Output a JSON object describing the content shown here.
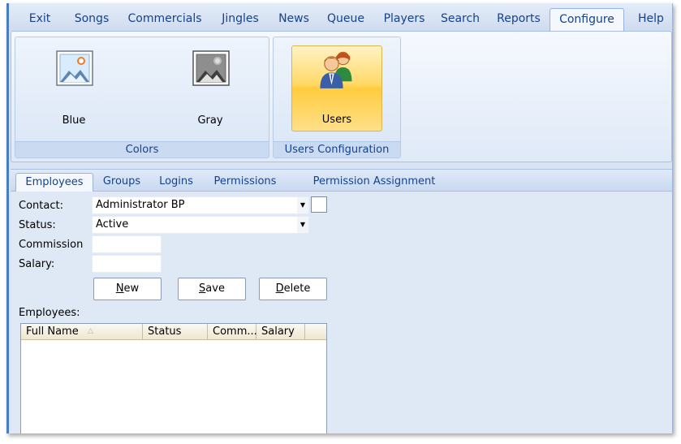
{
  "menu": {
    "tabs": [
      {
        "label": "Exit"
      },
      {
        "label": "Songs"
      },
      {
        "label": "Commercials"
      },
      {
        "label": "Jingles"
      },
      {
        "label": "News"
      },
      {
        "label": "Queue"
      },
      {
        "label": "Players"
      },
      {
        "label": "Search"
      },
      {
        "label": "Reports"
      },
      {
        "label": "Configure"
      },
      {
        "label": "Help"
      }
    ],
    "active": "Configure"
  },
  "ribbon": {
    "colors_group": {
      "label": "Colors",
      "buttons": [
        {
          "label": "Blue",
          "icon": "picture-blue-icon"
        },
        {
          "label": "Gray",
          "icon": "picture-gray-icon"
        }
      ]
    },
    "users_group": {
      "label": "Users Configuration",
      "buttons": [
        {
          "label": "Users",
          "icon": "users-icon"
        }
      ]
    }
  },
  "subtabs": [
    {
      "label": "Employees"
    },
    {
      "label": "Groups"
    },
    {
      "label": "Logins"
    },
    {
      "label": "Permissions"
    },
    {
      "label": "Permission Assignment"
    }
  ],
  "form": {
    "contact_label": "Contact:",
    "contact_value": "Administrator BP",
    "status_label": "Status:",
    "status_value": "Active",
    "commission_label": "Commission",
    "commission_value": "",
    "salary_label": "Salary:",
    "salary_value": "",
    "buttons": {
      "new": {
        "mnemonic": "N",
        "rest": "ew"
      },
      "save": {
        "mnemonic": "S",
        "rest": "ave"
      },
      "delete": {
        "mnemonic": "D",
        "rest": "elete"
      }
    }
  },
  "employees": {
    "label": "Employees:",
    "columns": [
      "Full Name",
      "Status",
      "Comm...",
      "Salary"
    ],
    "rows": []
  },
  "colors": {
    "accent": "#15428b",
    "selected": "#ffd968",
    "background": "#dfe8f5"
  }
}
